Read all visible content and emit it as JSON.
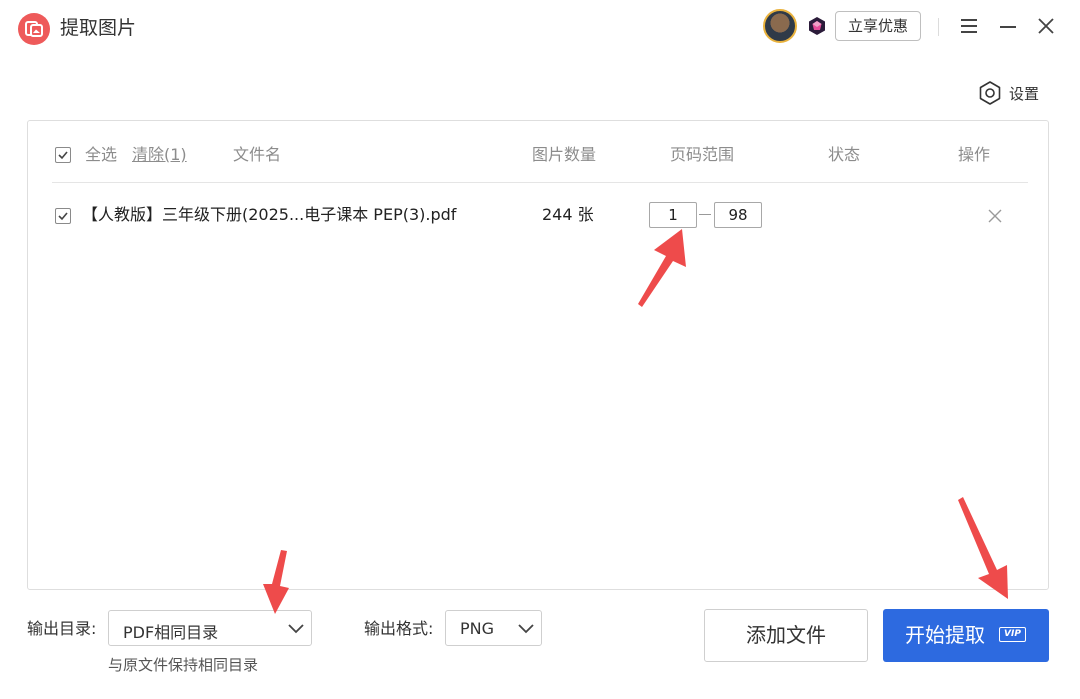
{
  "app": {
    "title": "提取图片"
  },
  "header": {
    "promo_label": "立享优惠"
  },
  "settings": {
    "label": "设置"
  },
  "table": {
    "headers": {
      "select_all": "全选",
      "clear": "清除(1)",
      "filename": "文件名",
      "image_count": "图片数量",
      "page_range": "页码范围",
      "status": "状态",
      "action": "操作"
    },
    "rows": [
      {
        "checked": true,
        "filename": "【人教版】三年级下册(2025...电子课本 PEP(3).pdf",
        "image_count": "244 张",
        "page_start": "1",
        "page_end": "98",
        "status": ""
      }
    ]
  },
  "output": {
    "dir_label": "输出目录:",
    "dir_value": "PDF相同目录",
    "dir_hint": "与原文件保持相同目录",
    "format_label": "输出格式:",
    "format_value": "PNG"
  },
  "buttons": {
    "add_file": "添加文件",
    "start": "开始提取",
    "vip_tag": "VIP"
  },
  "colors": {
    "primary": "#2d6ae0",
    "logo": "#ee5a5a",
    "annotation_arrow": "#ee4b4b"
  },
  "icons": [
    "app-logo-icon",
    "vip-diamond-icon",
    "menu-icon",
    "minimize-icon",
    "close-icon",
    "gear-icon",
    "checkbox-icon",
    "delete-row-icon",
    "chevron-down-icon"
  ]
}
